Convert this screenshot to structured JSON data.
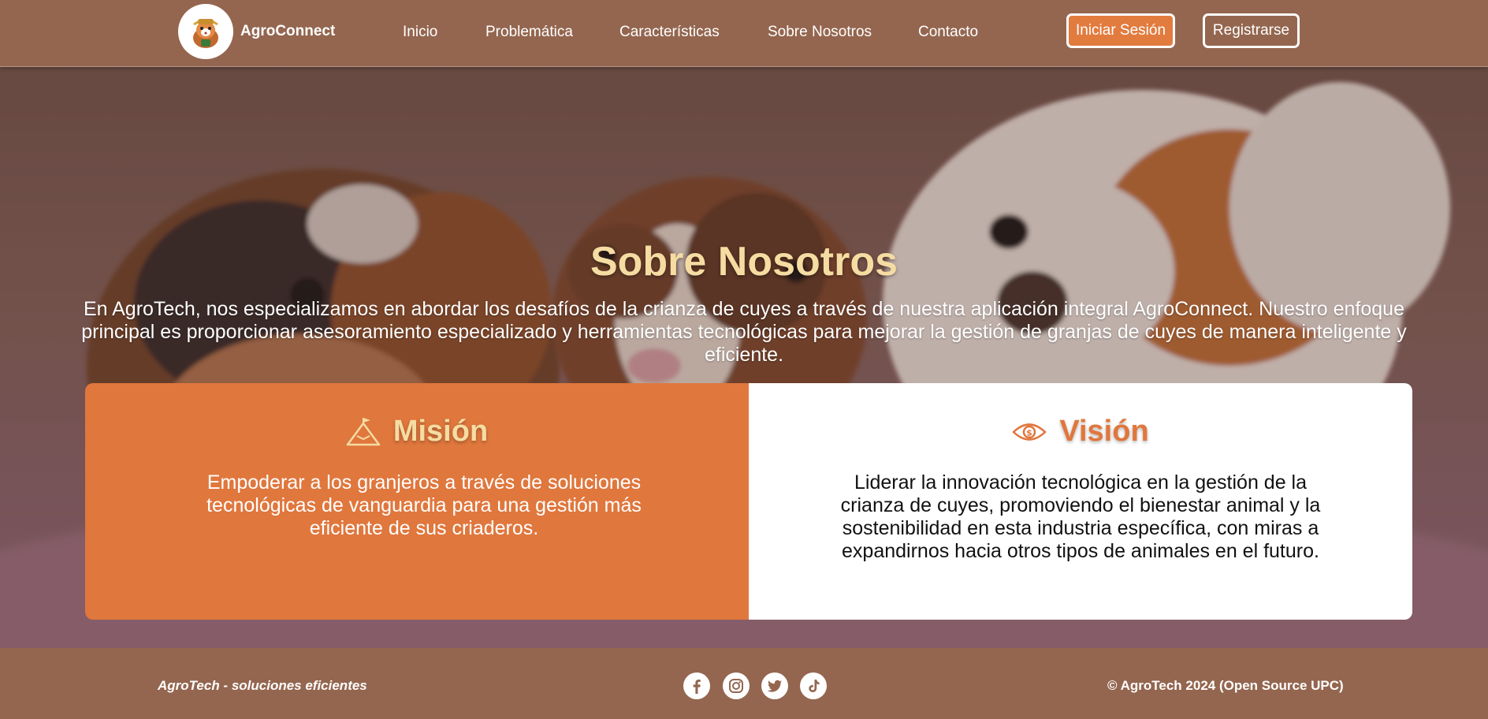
{
  "brand": {
    "name": "AgroConnect"
  },
  "nav": {
    "links": [
      "Inicio",
      "Problemática",
      "Características",
      "Sobre Nosotros",
      "Contacto"
    ],
    "login_label": "Iniciar Sesión",
    "register_label": "Registrarse"
  },
  "hero": {
    "title": "Sobre Nosotros",
    "text": "En AgroTech, nos especializamos en abordar los desafíos de la crianza de cuyes a través de nuestra aplicación integral AgroConnect. Nuestro enfoque principal es proporcionar asesoramiento especializado y herramientas tecnológicas para mejorar la gestión de granjas de cuyes de manera inteligente y eficiente."
  },
  "mision": {
    "icon": "mountain-flag-icon",
    "title": "Misión",
    "text": "Empoderar a los granjeros a través de soluciones tecnológicas de vanguardia para una gestión más eficiente de sus criaderos."
  },
  "vision": {
    "icon": "eye-icon",
    "title": "Visión",
    "text": "Liderar la innovación tecnológica en la gestión de la crianza de cuyes, promoviendo el bienestar animal y la sostenibilidad en esta industria específica, con miras a expandirnos hacia otros tipos de animales en el futuro."
  },
  "footer": {
    "tagline": "AgroTech - soluciones eficientes",
    "social_icons": [
      "facebook-icon",
      "instagram-icon",
      "twitter-icon",
      "tiktok-icon"
    ],
    "copyright": "© AgroTech 2024 (Open Source UPC)"
  },
  "colors": {
    "nav_bg": "#94664f",
    "accent": "#e0773d",
    "title_cream": "#f5dca2",
    "card_white": "#ffffff"
  }
}
